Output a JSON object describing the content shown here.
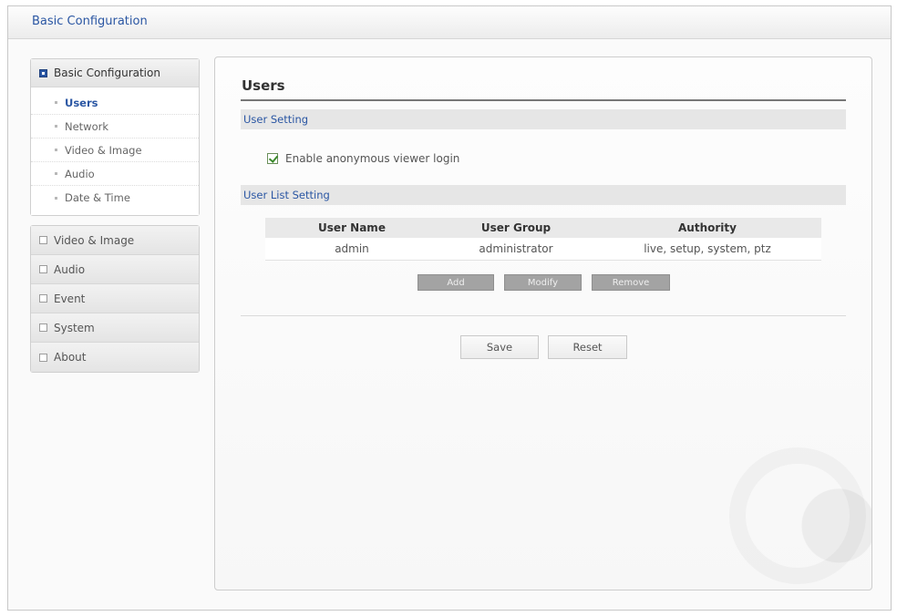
{
  "header": {
    "title": "Basic Configuration"
  },
  "sidebar": {
    "group_title": "Basic Configuration",
    "items": [
      {
        "label": "Users",
        "active": true
      },
      {
        "label": "Network"
      },
      {
        "label": "Video & Image"
      },
      {
        "label": "Audio"
      },
      {
        "label": "Date & Time"
      }
    ],
    "categories": [
      {
        "label": "Video & Image"
      },
      {
        "label": "Audio"
      },
      {
        "label": "Event"
      },
      {
        "label": "System"
      },
      {
        "label": "About"
      }
    ]
  },
  "main": {
    "title": "Users",
    "user_setting": {
      "header": "User Setting",
      "anonymous_label": "Enable anonymous viewer login",
      "anonymous_checked": true
    },
    "user_list": {
      "header": "User List Setting",
      "columns": [
        "User Name",
        "User Group",
        "Authority"
      ],
      "rows": [
        [
          "admin",
          "administrator",
          "live, setup, system, ptz"
        ]
      ],
      "buttons": {
        "add": "Add",
        "modify": "Modify",
        "remove": "Remove"
      }
    },
    "actions": {
      "save": "Save",
      "reset": "Reset"
    }
  },
  "colors": {
    "accent": "#2a56a3",
    "check": "#3b8a2c"
  }
}
